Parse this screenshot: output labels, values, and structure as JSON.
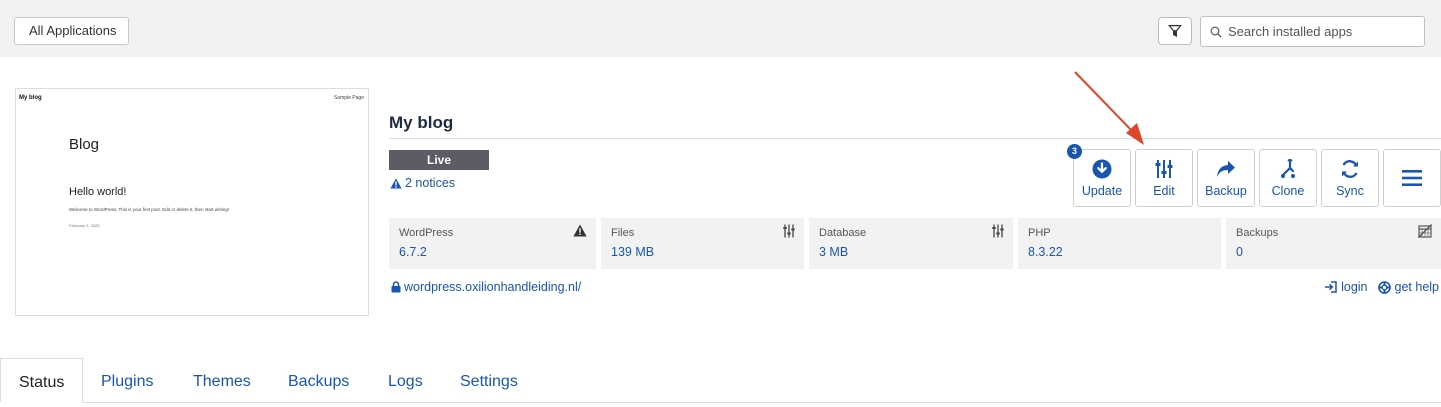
{
  "topbar": {
    "back_label": "All Applications",
    "search_placeholder": "Search installed apps"
  },
  "preview": {
    "site_name": "My blog",
    "nav_item": "Sample Page",
    "page_title": "Blog",
    "post_title": "Hello world!",
    "post_excerpt": "Welcome to WordPress. This is your first post. Edit or delete it, then start writing!",
    "post_date": "February 3, 2025"
  },
  "app": {
    "title": "My blog",
    "status": "Live",
    "notices": "2 notices",
    "domain": "wordpress.oxilionhandleiding.nl/"
  },
  "actions": [
    {
      "label": "Update",
      "icon": "download-circle-icon",
      "badge": "3"
    },
    {
      "label": "Edit",
      "icon": "sliders-icon"
    },
    {
      "label": "Backup",
      "icon": "share-arrow-icon"
    },
    {
      "label": "Clone",
      "icon": "fork-icon"
    },
    {
      "label": "Sync",
      "icon": "sync-icon"
    },
    {
      "label": "",
      "icon": "hamburger-menu-icon"
    }
  ],
  "stats": {
    "wordpress": {
      "label": "WordPress",
      "value": "6.7.2",
      "icon": "warning-icon"
    },
    "files": {
      "label": "Files",
      "value": "139 MB",
      "icon": "sliders-icon"
    },
    "database": {
      "label": "Database",
      "value": "3 MB",
      "icon": "sliders-icon"
    },
    "php": {
      "label": "PHP",
      "value": "8.3.22"
    },
    "backups": {
      "label": "Backups",
      "value": "0",
      "icon": "calendar-disabled-icon"
    }
  },
  "links": {
    "login": "login",
    "help": "get help"
  },
  "tabs": [
    "Status",
    "Plugins",
    "Themes",
    "Backups",
    "Logs",
    "Settings"
  ],
  "colors": {
    "accent": "#1a55b0",
    "live_badge": "#5c5c66",
    "annotation_arrow": "#e0452b"
  }
}
